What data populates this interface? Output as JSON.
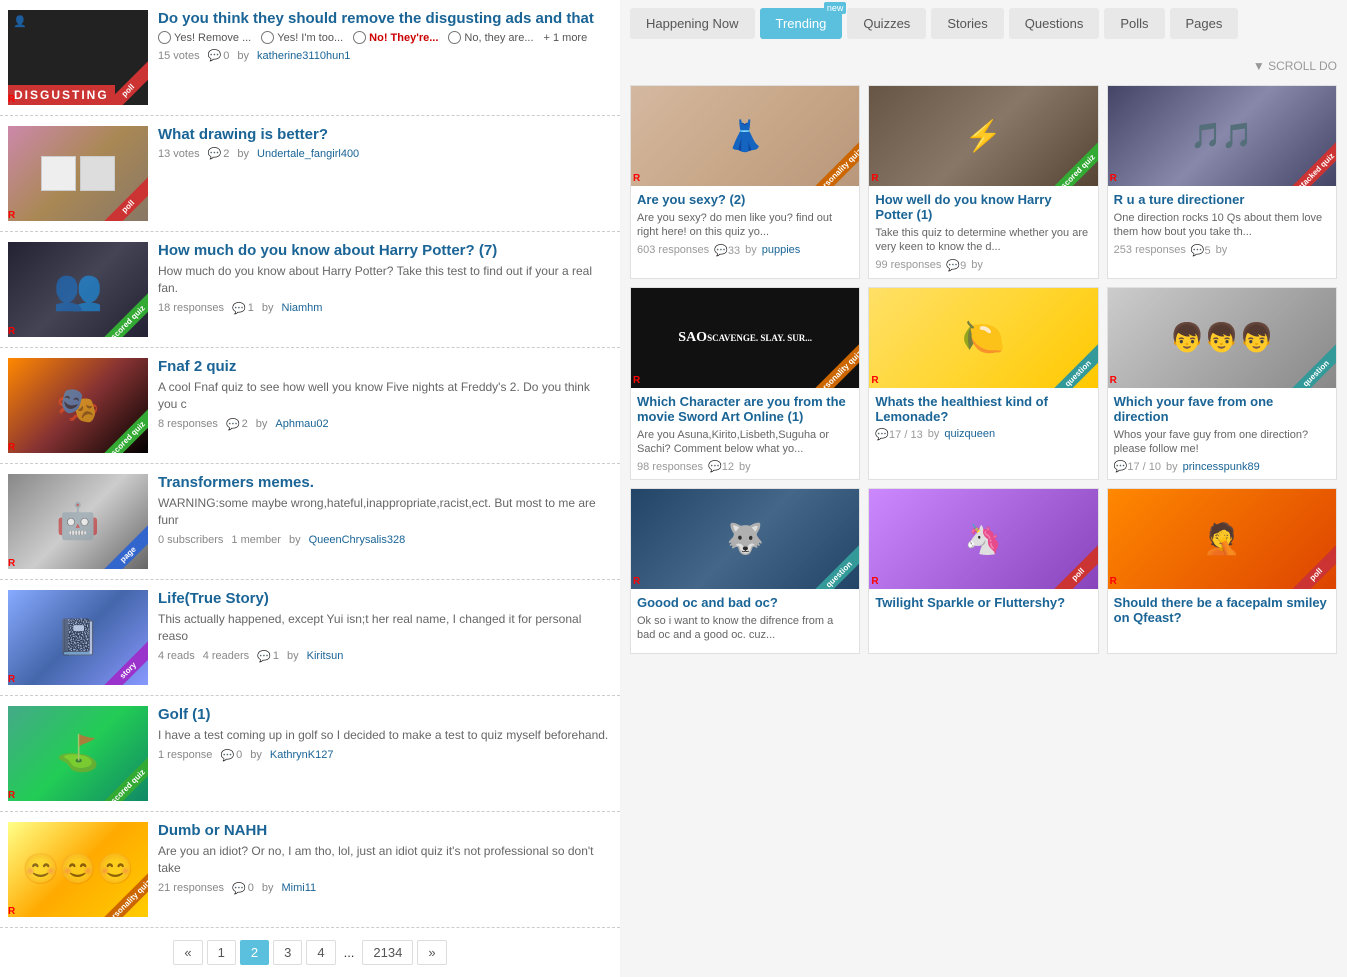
{
  "nav": {
    "happening_now": "Happening Now",
    "trending": "Trending",
    "trending_badge": "new",
    "quizzes": "Quizzes",
    "stories": "Stories",
    "questions": "Questions",
    "polls": "Polls",
    "pages": "Pages"
  },
  "scroll": "▼ SCROLL DO",
  "list_items": [
    {
      "id": "item1",
      "title": "Do you think they should remove the disgusting ads and that",
      "type": "poll",
      "thumb_class": "thumb-disgusting",
      "options": [
        "Yes! Remove ...",
        "Yes! I'm too...",
        "No! They're...",
        "No, they are...",
        "+ 1 more"
      ],
      "votes": "15 votes",
      "comments": "0",
      "author": "katherine3110hun1",
      "badge": "poll",
      "badge_label": ""
    },
    {
      "id": "item2",
      "title": "What drawing is better?",
      "type": "poll",
      "thumb_class": "thumb-drawing",
      "desc": "",
      "votes": "13 votes",
      "comments": "2",
      "author": "Undertale_fangirl400",
      "badge": "poll",
      "badge_label": "poll"
    },
    {
      "id": "item3",
      "title": "How much do you know about Harry Potter? (7)",
      "type": "scored",
      "thumb_class": "thumb-harry",
      "desc": "How much do you know about Harry Potter? Take this test to find out if your a real fan.",
      "meta": "18 responses",
      "comments": "1",
      "author": "Niamhm",
      "badge": "scored",
      "badge_label": "scored quiz"
    },
    {
      "id": "item4",
      "title": "Fnaf 2 quiz",
      "type": "scored",
      "thumb_class": "thumb-fnaf",
      "desc": "A cool Fnaf quiz to see how well you know Five nights at Freddy's 2. Do you think you c",
      "meta": "8 responses",
      "comments": "2",
      "author": "Aphmau02",
      "badge": "scored",
      "badge_label": "scored quiz"
    },
    {
      "id": "item5",
      "title": "Transformers memes.",
      "type": "page",
      "thumb_class": "thumb-transformers",
      "desc": "WARNING:some maybe wrong,hateful,inappropriate,racist,ect. But most to me are funr",
      "meta": "0 subscribers",
      "meta2": "1 member",
      "author": "QueenChrysalis328",
      "badge": "page",
      "badge_label": "page"
    },
    {
      "id": "item6",
      "title": "Life(True Story)",
      "type": "story",
      "thumb_class": "thumb-life",
      "desc": "This actually happened, except Yui isn;t her real name, I changed it for personal reaso",
      "meta": "4 reads",
      "meta2": "4 readers",
      "comments": "1",
      "author": "Kiritsun",
      "badge": "story",
      "badge_label": "story"
    },
    {
      "id": "item7",
      "title": "Golf (1)",
      "type": "scored",
      "thumb_class": "thumb-golf",
      "desc": "I have a test coming up in golf so I decided to make a test to quiz myself beforehand.",
      "meta": "1 response",
      "comments": "0",
      "author": "KathrynK127",
      "badge": "scored",
      "badge_label": "scored quiz"
    },
    {
      "id": "item8",
      "title": "Dumb or NAHH",
      "type": "personality",
      "thumb_class": "thumb-dumb",
      "desc": "Are you an idiot? Or no, I am tho, lol, just an idiot quiz it's not professional so don't take",
      "meta": "21 responses",
      "comments": "0",
      "author": "Mimi11",
      "badge": "personality",
      "badge_label": "personality quiz"
    }
  ],
  "pagination": {
    "prev": "«",
    "pages": [
      "1",
      "2",
      "3",
      "4",
      "...",
      "2134"
    ],
    "next": "»",
    "current": "2"
  },
  "grid_items": [
    {
      "id": "g1",
      "title": "Are you sexy? (2)",
      "desc": "Are you sexy? do men like you? find out right here! on this quiz yo...",
      "meta": "603 responses",
      "comments": "33",
      "author": "puppies",
      "thumb_class": "thumb-sexy",
      "badge": "personality quiz",
      "badge_color": "orange"
    },
    {
      "id": "g2",
      "title": "How well do you know Harry Potter (1)",
      "desc": "Take this quiz to determine whether you are very keen to know the d...",
      "meta": "99 responses",
      "comments": "9",
      "author": "",
      "thumb_class": "thumb-harry2",
      "badge": "scored quiz",
      "badge_color": "green"
    },
    {
      "id": "g3",
      "title": "R u a ture directioner",
      "desc": "One direction rocks 10 Qs about them love them how bout you take th...",
      "meta": "253 responses",
      "comments": "5",
      "author": "",
      "thumb_class": "thumb-directioner",
      "badge": "stacked quiz",
      "badge_color": "red"
    },
    {
      "id": "g4",
      "title": "Which Character are you from the movie Sword Art Online (1)",
      "desc": "Are you Asuna,Kirito,Lisbeth,Suguha or Sachi? Comment below what yo...",
      "meta": "98 responses",
      "comments": "12",
      "author": "",
      "thumb_class": "thumb-sword",
      "badge": "personality quiz",
      "badge_color": "orange"
    },
    {
      "id": "g5",
      "title": "Whats the healthiest kind of Lemonade?",
      "desc": "",
      "meta": "",
      "comments_label": "17",
      "comments_label2": "13",
      "author": "quizqueen",
      "thumb_class": "thumb-lemonade",
      "badge": "question",
      "badge_color": "teal"
    },
    {
      "id": "g6",
      "title": "Which your fave from one direction",
      "desc": "Whos your fave guy from one direction? please follow me!",
      "meta": "",
      "comments_label": "17",
      "comments_label2": "10",
      "author": "princesspunk89",
      "thumb_class": "thumb-1d",
      "badge": "question",
      "badge_color": "teal"
    },
    {
      "id": "g7",
      "title": "Goood oc and bad oc?",
      "desc": "Ok so i want to know the difrence from a bad oc and a good oc. cuz...",
      "meta": "",
      "thumb_class": "thumb-oc",
      "badge": "question",
      "badge_color": "teal"
    },
    {
      "id": "g8",
      "title": "Twilight Sparkle or Fluttershy?",
      "desc": "",
      "thumb_class": "thumb-mlp",
      "badge": "poll",
      "badge_color": "red"
    },
    {
      "id": "g9",
      "title": "Should there be a facepalm smiley on Qfeast?",
      "desc": "",
      "thumb_class": "thumb-facepalm",
      "badge": "poll",
      "badge_color": "red"
    }
  ]
}
